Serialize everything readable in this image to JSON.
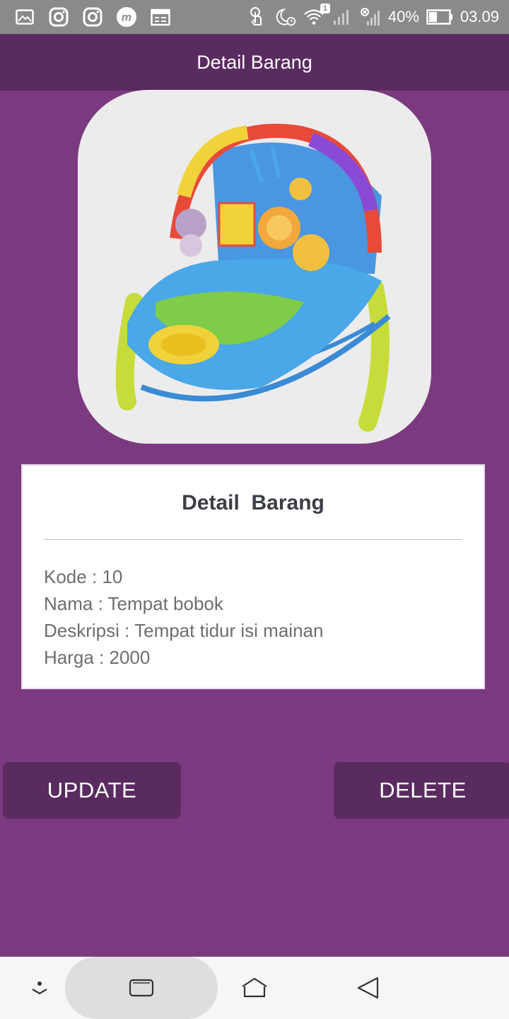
{
  "status_bar": {
    "left_icons": [
      "gallery-icon",
      "instagram-icon",
      "instagram-icon",
      "m-app-icon",
      "calendar-icon"
    ],
    "right_icons": [
      "touch-icon",
      "moon-alarm-icon",
      "wifi-icon",
      "signal-icon",
      "signal-off-icon"
    ],
    "wifi_badge": "1",
    "battery": "40%",
    "time": "03.09"
  },
  "appbar": {
    "title": "Detail Barang"
  },
  "product": {
    "image_desc": "baby-bouncer-image"
  },
  "card": {
    "title": "Detail  Barang",
    "lines": [
      "Kode : 10",
      "Nama : Tempat bobok",
      "Deskripsi : Tempat tidur isi mainan",
      "Harga : 2000"
    ]
  },
  "buttons": {
    "update": "UPDATE",
    "delete": "DELETE"
  },
  "navbar": {
    "icons": [
      "chevron-down-icon",
      "recents-icon",
      "home-icon",
      "back-icon"
    ]
  },
  "colors": {
    "background": "#7b3a80",
    "appbar": "#5a2b60",
    "button": "#5a2b60",
    "statusbar": "#8a8a8a"
  }
}
